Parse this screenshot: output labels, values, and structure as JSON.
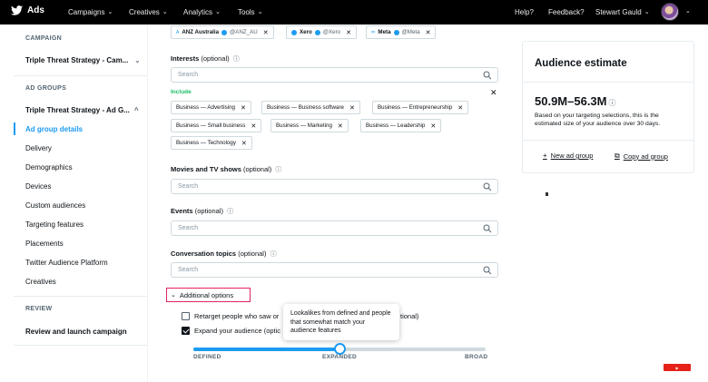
{
  "nav": {
    "brand": "Ads",
    "menus": [
      "Campaigns",
      "Creatives",
      "Analytics",
      "Tools"
    ],
    "help": "Help?",
    "feedback": "Feedback?",
    "user": "Stewart Gauld"
  },
  "sidebar": {
    "campaign_heading": "CAMPAIGN",
    "campaign_name": "Triple Threat Strategy - Cam...",
    "ad_groups_heading": "AD GROUPS",
    "ad_group_name": "Triple Threat Strategy - Ad G...",
    "items": [
      "Ad group details",
      "Delivery",
      "Demographics",
      "Devices",
      "Custom audiences",
      "Targeting features",
      "Placements",
      "Twitter Audience Platform",
      "Creatives"
    ],
    "review_heading": "REVIEW",
    "review_item": "Review and launch campaign"
  },
  "main": {
    "top_chips": [
      {
        "icon": "A",
        "name": "ANZ Australia",
        "handle": "@ANZ_AU"
      },
      {
        "icon": "dot",
        "name": "Xero",
        "handle": "@Xero"
      },
      {
        "icon": "∞",
        "name": "Meta",
        "handle": "@Meta"
      }
    ],
    "interests": {
      "label": "Interests",
      "optional": "(optional)",
      "placeholder": "Search",
      "include_label": "Include",
      "chips": [
        "Business — Advertising",
        "Business — Business software",
        "Business — Entrepreneurship",
        "Business — Small business",
        "Business — Marketing",
        "Business — Leadership",
        "Business — Technology"
      ]
    },
    "movies": {
      "label": "Movies and TV shows",
      "optional": "(optional)",
      "placeholder": "Search"
    },
    "events": {
      "label": "Events",
      "optional": "(optional)",
      "placeholder": "Search"
    },
    "conversation": {
      "label": "Conversation topics",
      "optional": "(optional)",
      "placeholder": "Search"
    },
    "additional_options": "Additional options",
    "retarget_label": "Retarget people who saw or",
    "retarget_suffix": "tional)",
    "expand_label": "Expand your audience (optic",
    "tooltip": "Lookalikes from defined and people that somewhat match your audience features",
    "slider": {
      "labels": [
        "DEFINED",
        "EXPANDED",
        "BROAD"
      ],
      "value": 0.5
    },
    "retarget_checked": false,
    "expand_checked": true
  },
  "estimate": {
    "title": "Audience estimate",
    "range": "50.9M–56.3M",
    "description": "Based on your targeting selections, this is the estimated size of your audience over 30 days.",
    "new_ad_group": "New ad group",
    "copy_ad_group": "Copy ad group"
  },
  "colors": {
    "accent": "#1d9bf0",
    "include": "#17bf63",
    "highlight": "#e0245e"
  }
}
